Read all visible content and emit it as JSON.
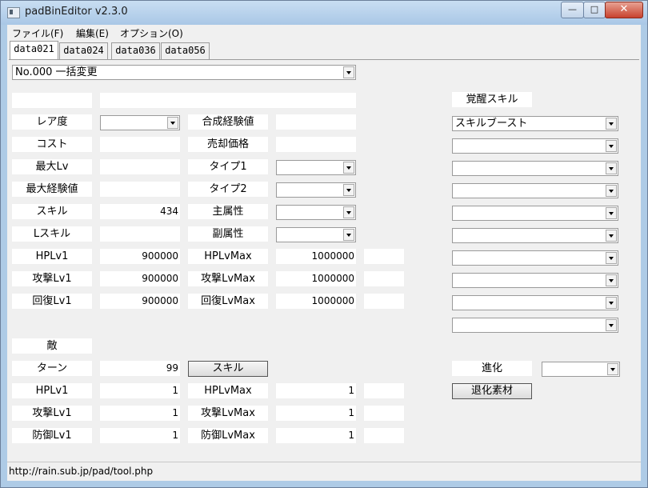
{
  "window": {
    "title": "padBinEditor v2.3.0",
    "min": "—",
    "max": "□",
    "close": "✕"
  },
  "menu": [
    "ファイル(F)",
    "編集(E)",
    "オプション(O)"
  ],
  "tabs": [
    "data021",
    "data024",
    "data036",
    "data056"
  ],
  "selector": {
    "value": "No.000 一括変更"
  },
  "monster": {
    "rarity_label": "レア度",
    "cost_label": "コスト",
    "maxlv_label": "最大Lv",
    "maxexp_label": "最大経験値",
    "skill_label": "スキル",
    "skill_value": "434",
    "lskill_label": "Lスキル",
    "hp_lv1_label": "HPLv1",
    "hp_lv1": "900000",
    "atk_lv1_label": "攻撃Lv1",
    "atk_lv1": "900000",
    "rcv_lv1_label": "回復Lv1",
    "rcv_lv1": "900000",
    "fuse_exp_label": "合成経験値",
    "sell_label": "売却価格",
    "type1_label": "タイプ1",
    "type2_label": "タイプ2",
    "main_attr_label": "主属性",
    "sub_attr_label": "副属性",
    "hp_max_label": "HPLvMax",
    "hp_max": "1000000",
    "atk_max_label": "攻撃LvMax",
    "atk_max": "1000000",
    "rcv_max_label": "回復LvMax",
    "rcv_max": "1000000"
  },
  "enemy": {
    "label": "敵",
    "turn_label": "ターン",
    "turn": "99",
    "skill_button": "スキル",
    "hp_lv1_label": "HPLv1",
    "hp_lv1": "1",
    "atk_lv1_label": "攻撃Lv1",
    "atk_lv1": "1",
    "def_lv1_label": "防御Lv1",
    "def_lv1": "1",
    "hp_max_label": "HPLvMax",
    "hp_max": "1",
    "atk_max_label": "攻撃LvMax",
    "atk_max": "1",
    "def_max_label": "防御LvMax",
    "def_max": "1"
  },
  "awaken": {
    "label": "覚醒スキル",
    "first": "スキルブースト"
  },
  "evolve": {
    "label": "進化",
    "button": "退化素材"
  },
  "status": "http://rain.sub.jp/pad/tool.php"
}
